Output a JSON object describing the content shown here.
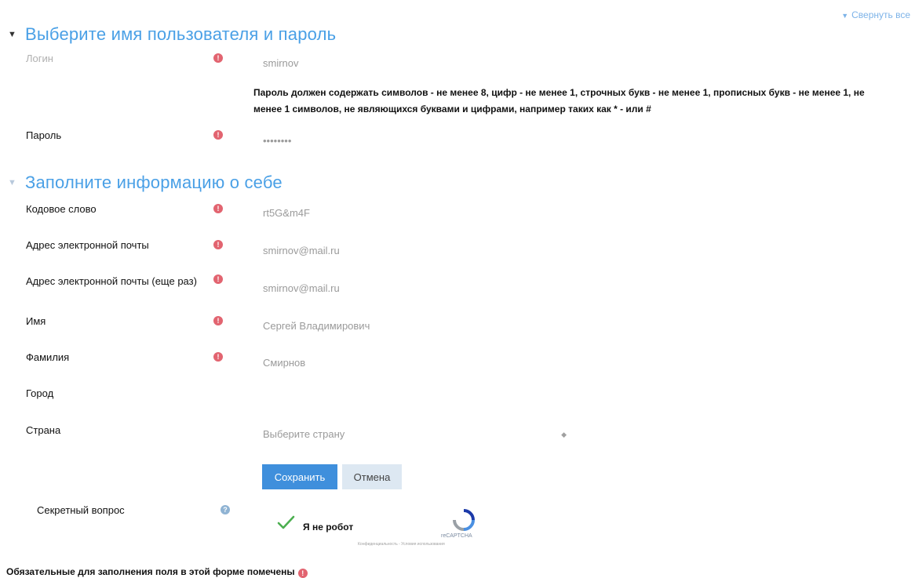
{
  "header": {
    "collapse_all": "Свернуть все"
  },
  "section_account": {
    "title": "Выберите имя пользователя и пароль",
    "username_label": "Логин",
    "username_value": "smirnov",
    "password_hint": "Пароль должен содержать символов - не менее 8, цифр - не менее 1, строчных букв - не менее 1, прописных букв - не менее 1, не менее 1 символов, не являющихся буквами и цифрами, например таких как * - или #",
    "password_label": "Пароль",
    "password_value": "••••••••"
  },
  "section_profile": {
    "title": "Заполните информацию о себе",
    "fields": {
      "codeword_label": "Кодовое слово",
      "codeword_value": "rt5G&m4F",
      "email_label": "Адрес электронной почты",
      "email_value": "smirnov@mail.ru",
      "email2_label": "Адрес электронной почты (еще раз)",
      "email2_value": "smirnov@mail.ru",
      "firstname_label": "Имя",
      "firstname_value": "Сергей Владимирович",
      "lastname_label": "Фамилия",
      "lastname_value": "Смирнов",
      "city_label": "Город",
      "city_value": "",
      "country_label": "Страна",
      "country_value": "Выберите страну"
    }
  },
  "buttons": {
    "save": "Сохранить",
    "cancel": "Отмена"
  },
  "secret": {
    "label": "Секретный вопрос"
  },
  "captcha": {
    "text": "Я не робот",
    "brand": "reCAPTCHA",
    "terms": "Конфиденциальность - Условия использования"
  },
  "footer": {
    "required_note": "Обязательные для заполнения поля в этой форме помечены"
  },
  "icons": {
    "required": "required-icon",
    "help": "help-icon",
    "caret": "caret-down-icon",
    "checkmark": "checkmark-icon",
    "recaptcha": "recaptcha-logo-icon"
  },
  "colors": {
    "accent": "#4aa0e6",
    "primary_button": "#3f8fdc",
    "required": "#e26470",
    "check_green": "#4caf50"
  }
}
